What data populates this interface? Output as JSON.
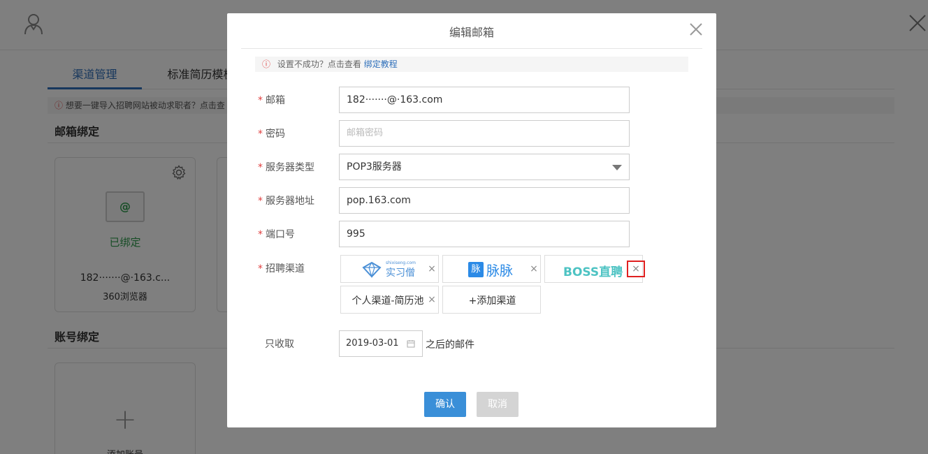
{
  "background": {
    "tabs": [
      {
        "label": "渠道管理"
      },
      {
        "label": "标准简历模板"
      }
    ],
    "tab_suffix_icon": "check-circle-icon",
    "notice": "想要一键导入招聘网站被动求职者？点击查",
    "mailbox_section_title": "邮箱绑定",
    "account_section_title": "账号绑定",
    "mail_card": {
      "status": "已绑定",
      "email": "182·······@·163.c...",
      "browser": "360浏览器"
    },
    "add_card_label": "添加账号"
  },
  "modal": {
    "title": "编辑邮箱",
    "tip": {
      "text": "设置不成功？点击查看",
      "link": "绑定教程"
    },
    "fields": {
      "email": {
        "label": "邮箱",
        "value": "182·······@·163.com"
      },
      "password": {
        "label": "密码",
        "placeholder": "邮箱密码"
      },
      "server_type": {
        "label": "服务器类型",
        "value": "POP3服务器"
      },
      "server_address": {
        "label": "服务器地址",
        "value": "pop.163.com"
      },
      "port": {
        "label": "端口号",
        "value": "995"
      },
      "channels": {
        "label": "招聘渠道",
        "items": [
          {
            "name": "实习僧",
            "small": "shixiseng.com",
            "icon": "shixiseng-logo"
          },
          {
            "name": "脉脉",
            "badge": "脉",
            "icon": "maimai-logo"
          },
          {
            "name": "BOSS直聘",
            "icon": "boss-zhipin-logo"
          },
          {
            "name": "个人渠道-简历池"
          }
        ],
        "add_label": "+添加渠道",
        "remove_glyph": "×"
      },
      "receive_after": {
        "label": "只收取",
        "date": "2019-03-01",
        "suffix": "之后的邮件"
      }
    },
    "confirm_label": "确认",
    "cancel_label": "取消"
  }
}
